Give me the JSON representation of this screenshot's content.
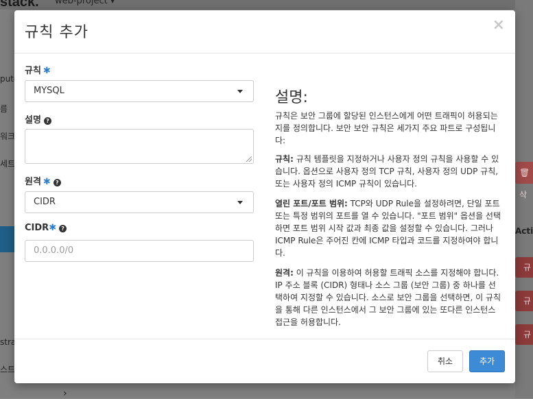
{
  "background": {
    "brand": "stack.",
    "project_selector": "web-project ▾",
    "sidebar_items": [
      "pute",
      "름",
      "워크",
      "세트",
      "stra",
      "스트"
    ],
    "delete_button": "삭",
    "actions_header": "Actio",
    "row_buttons": [
      "규",
      "규",
      "규"
    ],
    "chevron": "›"
  },
  "modal": {
    "title": "규칙 추가",
    "close_symbol": "×",
    "form": {
      "rule_label": "규칙",
      "rule_value": "MYSQL",
      "description_label": "설명",
      "remote_label": "원격",
      "remote_value": "CIDR",
      "cidr_label": "CIDR",
      "cidr_placeholder": "0.0.0.0/0",
      "required_mark": "✱",
      "help_icon": "?"
    },
    "help": {
      "title": "설명:",
      "intro": "규칙은 보안 그룹에 할당된 인스턴스에게 어떤 트래픽이 허용되는지를 정의합니다. 보안 보안 규칙은 세가지 주요 파트로 구성됩니다:",
      "rule_term": "규칙:",
      "rule_text": " 규칙 템플릿을 지정하거나 사용자 정의 규칙을 사용할 수 있습니다. 옵션으로 사용자 정의 TCP 규칙, 사용자 정의 UDP 규칙, 또는 사용자 정의 ICMP 규칙이 있습니다.",
      "port_term": "열린 포트/포트 범위:",
      "port_text": " TCP와 UDP Rule을 설정하려면, 단일 포트 또는 특정 범위의 포트를 열 수 있습니다. \"포트 범위\" 옵션을 선택하면 포트 범위 시작 값과 최종 값을 설정할 수 있습니다. 그러나 ICMP Rule은 주어진 칸에 ICMP 타입과 코드를 지정하여야 합니다.",
      "remote_term": "원격:",
      "remote_text": " 이 규칙을 이용하여 허용할 트래픽 소스를 지정해야 합니다. IP 주소 블록 (CIDR) 형태나 소스 그룹 (보안 그룹) 중 하나를 선택하여 지정할 수 있습니다. 소스로 보안 그룹을 선택하면, 이 규칙을 통해 다른 인스턴스에서 그 보안 그룹에 있는 또다른 인스턴스 접근을 허용합니다."
    },
    "footer": {
      "cancel_label": "취소",
      "add_label": "추가"
    }
  },
  "colors": {
    "primary": "#3d8ad6",
    "required": "#2f7fc8",
    "danger": "#8c3a3a"
  }
}
